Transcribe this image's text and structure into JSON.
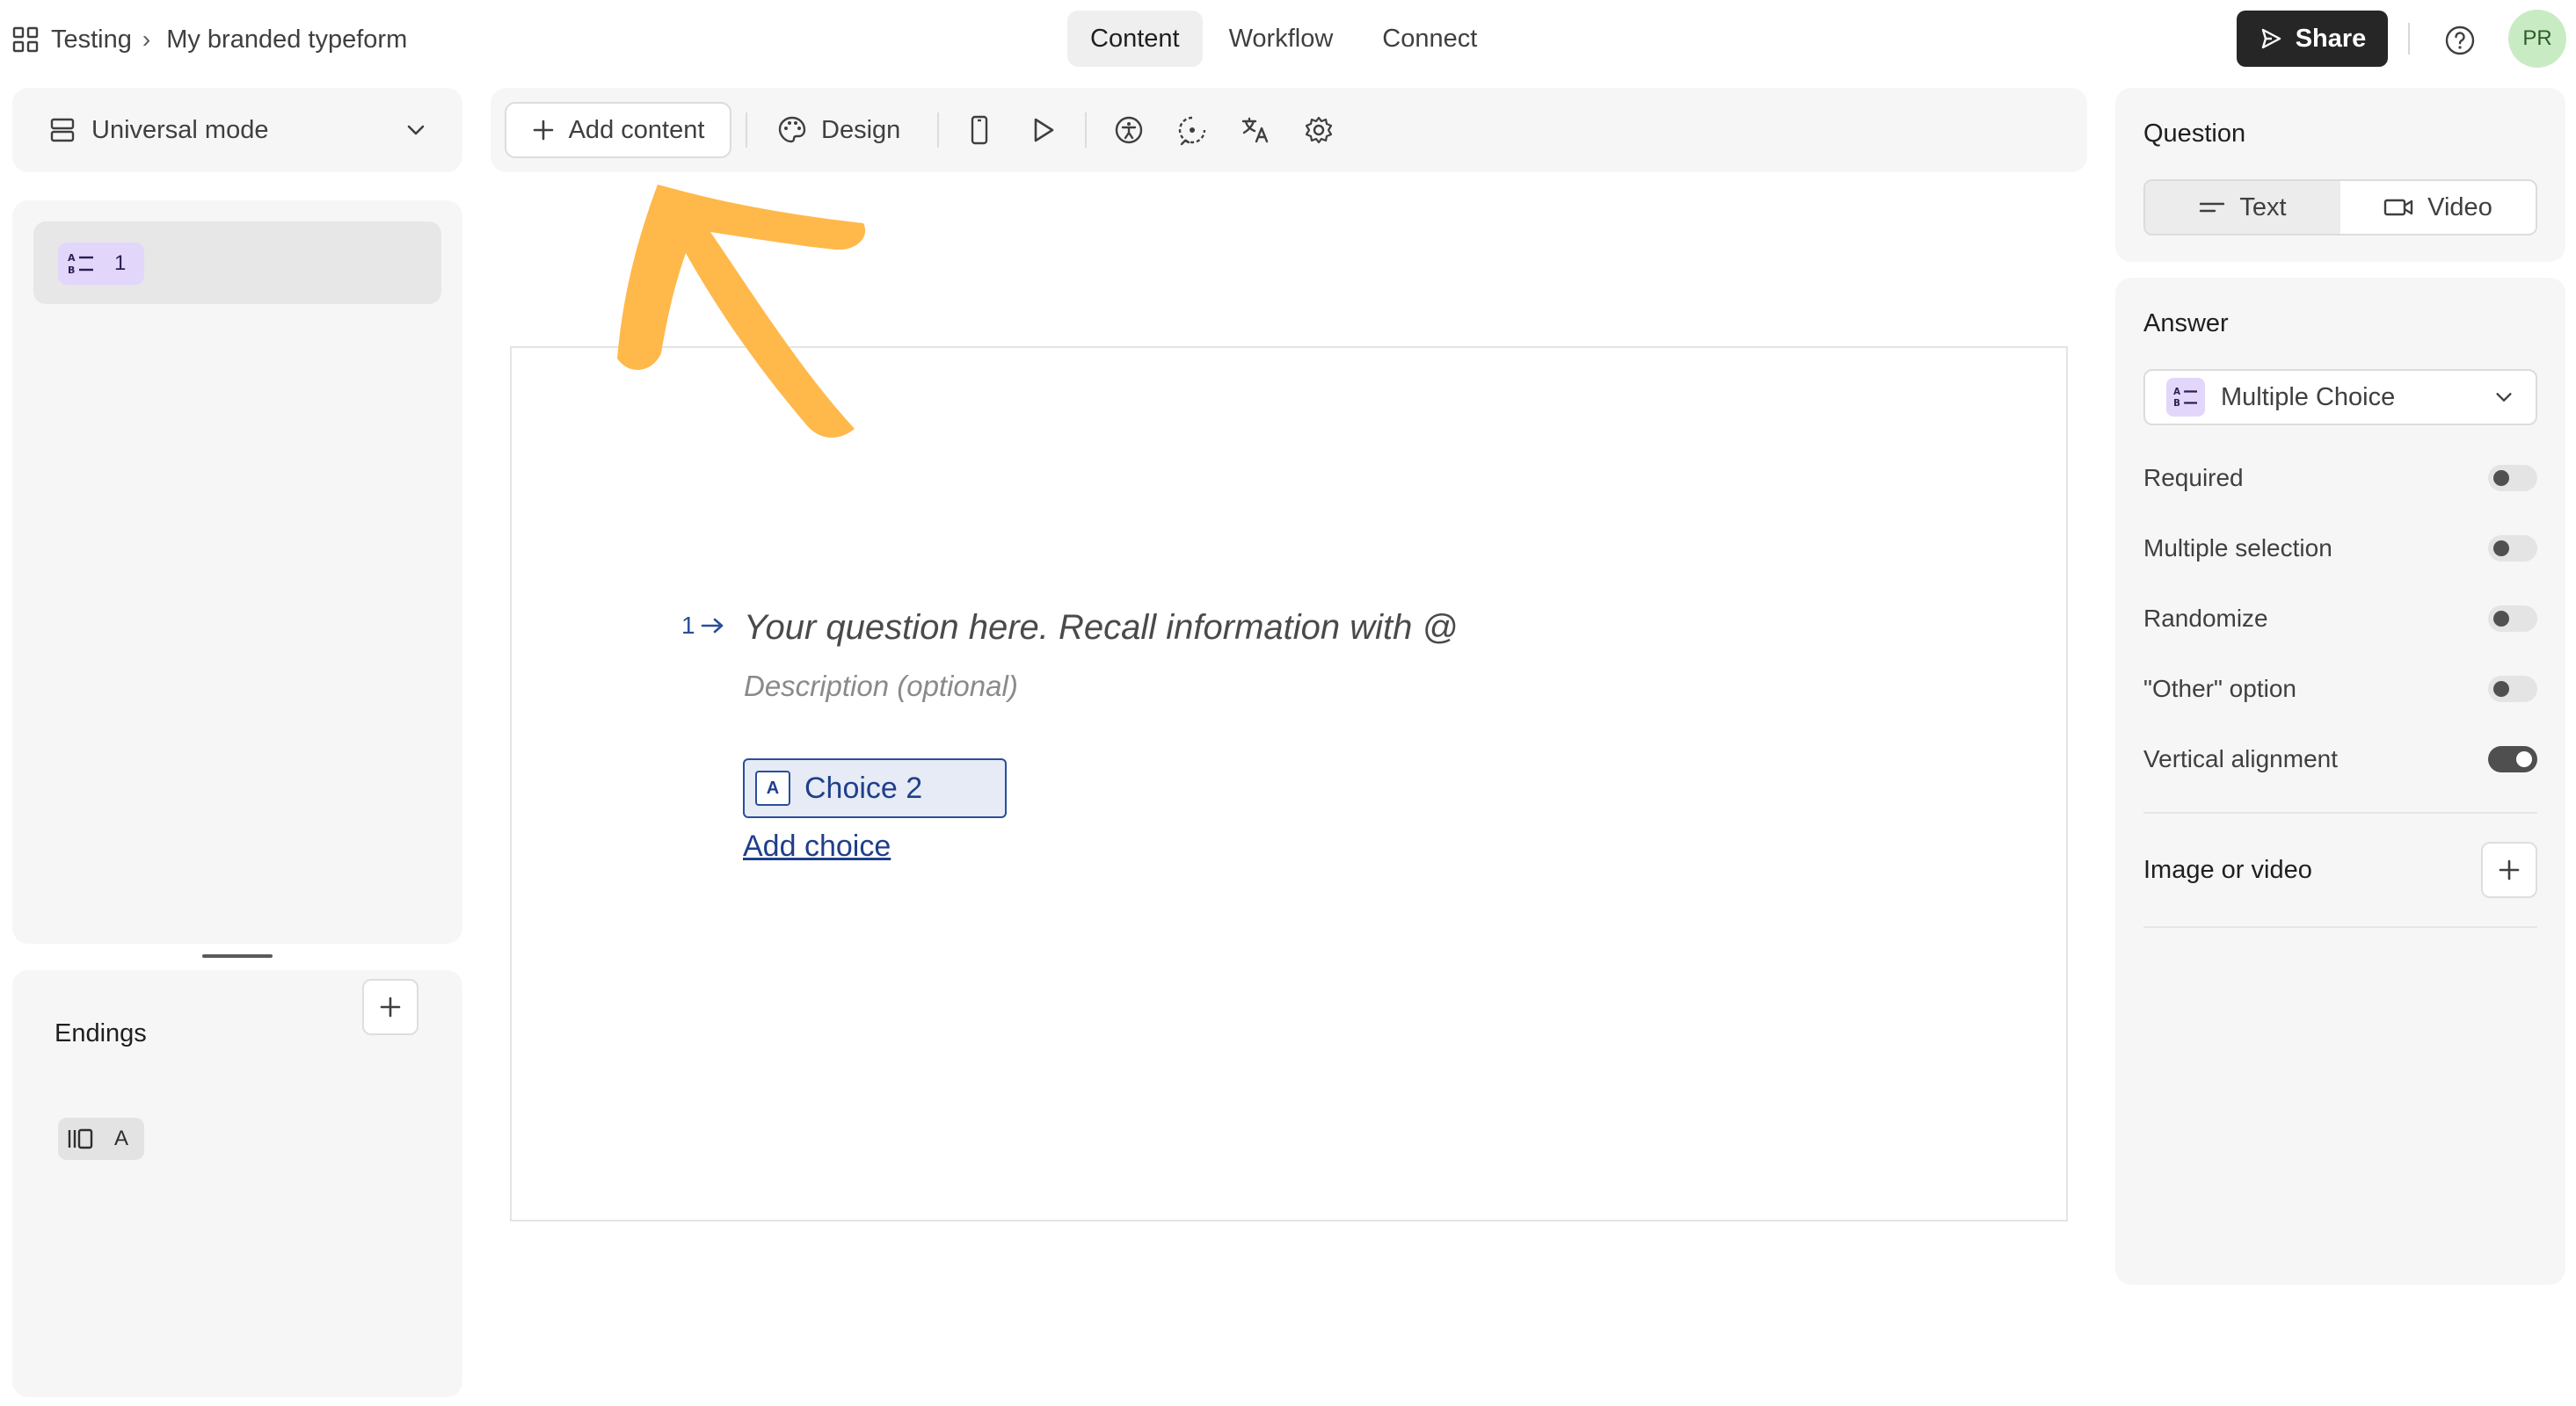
{
  "topbar": {
    "workspace": "Testing",
    "form_name": "My branded typeform",
    "tabs": [
      {
        "label": "Content",
        "active": true
      },
      {
        "label": "Workflow",
        "active": false
      },
      {
        "label": "Connect",
        "active": false
      }
    ],
    "share_label": "Share",
    "avatar_initials": "PR"
  },
  "left": {
    "mode_label": "Universal mode",
    "questions": [
      {
        "number": "1",
        "type_icon": "multiple-choice-icon"
      }
    ],
    "endings_title": "Endings",
    "endings": [
      {
        "label": "A",
        "type_icon": "ending-icon"
      }
    ]
  },
  "toolbar": {
    "add_content_label": "Add content",
    "design_label": "Design"
  },
  "canvas": {
    "question_number": "1",
    "question_placeholder": "Your question here. Recall information with @",
    "description_placeholder": "Description (optional)",
    "choices": [
      {
        "key": "A",
        "label": "Choice 2"
      }
    ],
    "add_choice_label": "Add choice"
  },
  "right": {
    "question_title": "Question",
    "question_modes": [
      {
        "label": "Text",
        "active": true
      },
      {
        "label": "Video",
        "active": false
      }
    ],
    "answer_title": "Answer",
    "answer_type": "Multiple Choice",
    "options": [
      {
        "label": "Required",
        "on": false
      },
      {
        "label": "Multiple selection",
        "on": false
      },
      {
        "label": "Randomize",
        "on": false
      },
      {
        "label": "\"Other\" option",
        "on": false
      },
      {
        "label": "Vertical alignment",
        "on": true
      }
    ],
    "media_title": "Image or video"
  },
  "colors": {
    "accent_blue": "#2a4e9a",
    "annotation_arrow": "#ffb84a",
    "share_bg": "#262627",
    "badge_purple": "#e2d6fb"
  }
}
